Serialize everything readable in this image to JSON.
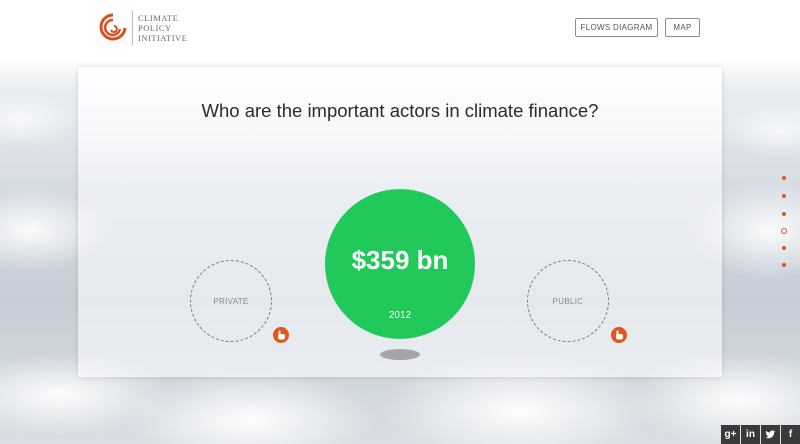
{
  "header": {
    "logo": {
      "lines": [
        "CLIMATE",
        "POLICY",
        "INITIATIVE"
      ],
      "icon": "cpi-swirl-logo"
    },
    "nav": [
      {
        "label": "FLOWS DIAGRAM"
      },
      {
        "label": "MAP"
      }
    ]
  },
  "main": {
    "question": "Who are the important actors in climate finance?",
    "total": {
      "amount": "$359 bn",
      "year": "2012"
    },
    "private": {
      "label": "PRIVATE",
      "icon": "hand-pointer-icon"
    },
    "public": {
      "label": "PUBLIC",
      "icon": "hand-pointer-icon"
    }
  },
  "side_nav": {
    "count": 6,
    "active_index": 3
  },
  "social": [
    "g+",
    "in",
    "t",
    "f"
  ],
  "colors": {
    "accent": "#e0571c",
    "total_circle": "#21c95b",
    "text": "#2b2b2b"
  }
}
